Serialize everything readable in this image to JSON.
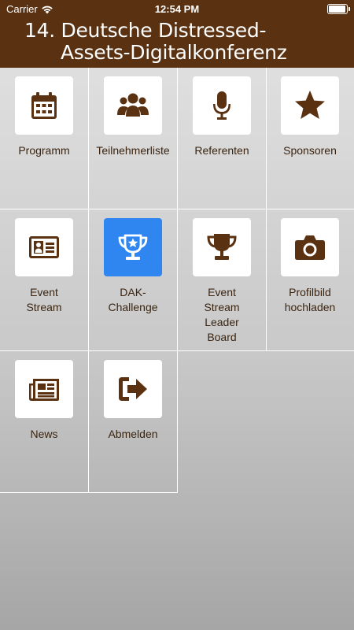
{
  "status_bar": {
    "carrier": "Carrier",
    "time": "12:54 PM",
    "battery_level": 1.0
  },
  "header": {
    "title_line1": "14. Deutsche Distressed-",
    "title_line2": "Assets-Digitalkonferenz"
  },
  "colors": {
    "header_bg": "#5a3212",
    "icon_brown": "#5a3212",
    "active_blue": "#2f86f0"
  },
  "menu": [
    {
      "label": "Programm",
      "icon": "calendar-icon",
      "active": false
    },
    {
      "label": "Teilnehmerliste",
      "icon": "users-icon",
      "active": false
    },
    {
      "label": "Referenten",
      "icon": "microphone-icon",
      "active": false
    },
    {
      "label": "Sponsoren",
      "icon": "star-icon",
      "active": false
    },
    {
      "label": "Event\nStream",
      "icon": "id-card-icon",
      "active": false
    },
    {
      "label": "DAK-\nChallenge",
      "icon": "trophy-star-icon",
      "active": true
    },
    {
      "label": "Event\nStream\nLeader\nBoard",
      "icon": "trophy-icon",
      "active": false
    },
    {
      "label": "Profilbild\nhochladen",
      "icon": "camera-icon",
      "active": false
    },
    {
      "label": "News",
      "icon": "newspaper-icon",
      "active": false
    },
    {
      "label": "Abmelden",
      "icon": "sign-out-icon",
      "active": false
    }
  ]
}
